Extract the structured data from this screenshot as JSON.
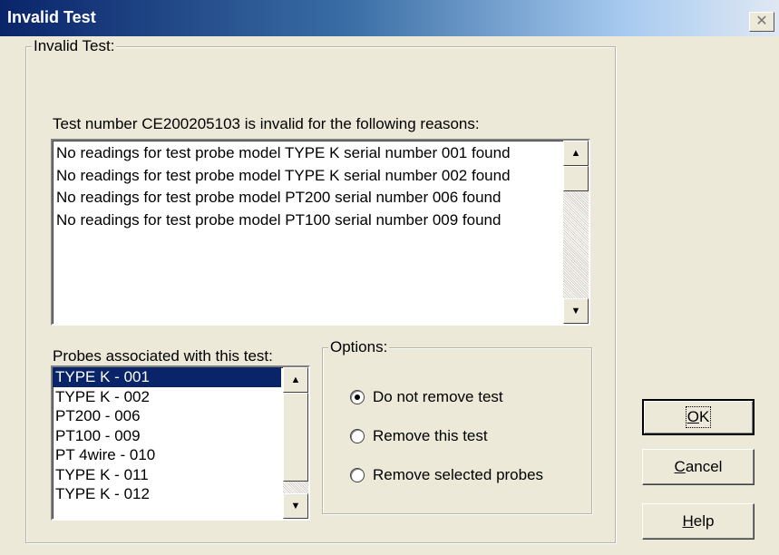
{
  "window": {
    "title": "Invalid Test",
    "close_glyph": "✕"
  },
  "invalid_group": {
    "legend": "Invalid Test:",
    "intro": "Test number CE200205103 is invalid for the following reasons:",
    "reasons": "No readings for test probe model TYPE K serial number 001 found\nNo readings for test probe model TYPE K serial number 002 found\nNo readings for test probe model PT200 serial number 006 found\nNo readings for test probe model PT100 serial number 009 found"
  },
  "probes": {
    "label": "Probes associated with this test:",
    "items": [
      "TYPE K - 001",
      "TYPE K - 002",
      "PT200 - 006",
      "PT100 - 009",
      "PT 4wire - 010",
      "TYPE K - 011",
      "TYPE K - 012"
    ],
    "selected_index": 0
  },
  "options": {
    "legend": "Options:",
    "items": [
      {
        "label": "Do not remove test",
        "checked": true
      },
      {
        "label": "Remove this test",
        "checked": false
      },
      {
        "label": "Remove selected probes",
        "checked": false
      }
    ]
  },
  "buttons": {
    "ok": {
      "accel": "O",
      "rest": "K"
    },
    "cancel": {
      "accel": "C",
      "rest": "ancel"
    },
    "help": {
      "accel": "H",
      "rest": "elp"
    }
  },
  "icons": {
    "scroll_up": "▲",
    "scroll_down": "▼"
  }
}
